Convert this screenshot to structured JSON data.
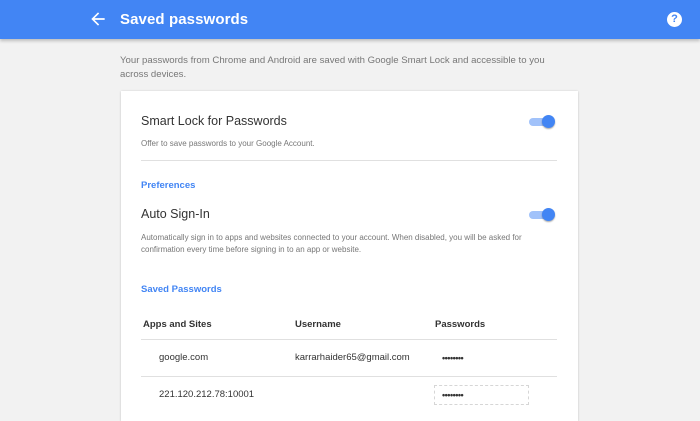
{
  "header": {
    "title": "Saved passwords",
    "back_icon": "arrow-back-icon",
    "help_icon": "help-icon",
    "help_glyph": "?",
    "bar_color": "#4285f4"
  },
  "intro": "Your passwords from Chrome and Android are saved with Google Smart Lock and accessible to you across devices.",
  "smart_lock": {
    "title": "Smart Lock for Passwords",
    "description": "Offer to save passwords to your Google Account.",
    "enabled": true
  },
  "preferences": {
    "heading": "Preferences",
    "auto_sign_in": {
      "title": "Auto Sign-In",
      "description": "Automatically sign in to apps and websites connected to your account. When disabled, you will be asked for confirmation every time before signing in to an app or website.",
      "enabled": true
    }
  },
  "saved_passwords": {
    "heading": "Saved Passwords",
    "columns": [
      "Apps and Sites",
      "Username",
      "Passwords"
    ],
    "rows": [
      {
        "site": "google.com",
        "username": "karrarhaider65@gmail.com",
        "password": "••••••••"
      },
      {
        "site": "221.120.212.78:10001",
        "username": "",
        "password": "••••••••"
      }
    ]
  },
  "accent_color": "#4285f4"
}
